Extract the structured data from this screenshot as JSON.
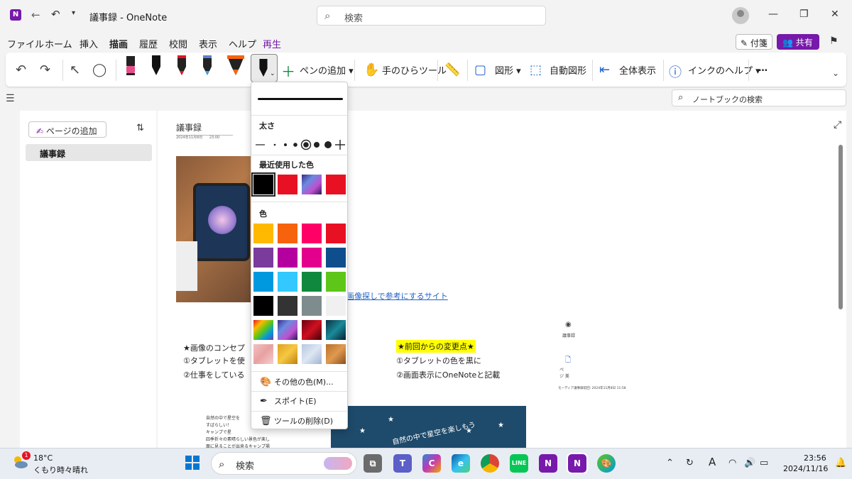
{
  "window": {
    "title": "議事録 - OneNote",
    "app_icon": "N"
  },
  "search": {
    "placeholder": "検索"
  },
  "menubar": {
    "items": [
      "ファイル",
      "ホーム",
      "挿入",
      "描画",
      "履歴",
      "校閲",
      "表示",
      "ヘルプ",
      "再生"
    ],
    "active": "描画",
    "memo_label": "付箋",
    "share_label": "共有"
  },
  "ribbon": {
    "add_pen_label": "ペンの追加",
    "hand_tool_label": "手のひらツール",
    "shapes_label": "図形",
    "auto_shapes_label": "自動図形",
    "fit_label": "全体表示",
    "ink_help_label": "インクのヘルプ",
    "more_label": "…"
  },
  "notebook_search": {
    "placeholder": "ノートブックの検索"
  },
  "pages": {
    "add_label": "ページの追加",
    "items": [
      "議事録"
    ]
  },
  "page": {
    "title": "議事録",
    "date": "2024年11月8日",
    "time": "23:00",
    "link_text": "画像探しで参考にするサイト",
    "left_notes": [
      "★画像のコンセプ",
      "①タブレットを使",
      "②仕事をしている"
    ],
    "changes_title": "★前回からの変更点★",
    "changes": [
      "①タブレットの色を黒に",
      "②画面表示にOneNoteと記載"
    ],
    "icon_label_1": "議事録",
    "icon_label_2": "ペ\nジ 美",
    "footer_small": "モーディア議事録前回: 2024年11月8日 11:58",
    "small_notes": [
      "自然の中で星空を",
      "すばらしい！",
      "キャンプで星",
      "四季折々の素晴らしい景色が楽し",
      "面に見ることが出来るキャンプ場"
    ],
    "poster_text": "自然の中で星空を楽しもう"
  },
  "dropdown": {
    "thickness_label": "太さ",
    "recent_label": "最近使用した色",
    "colors_label": "色",
    "recent_colors": [
      "#000000",
      "#e81123",
      "galaxy",
      "#e81123"
    ],
    "colors": [
      [
        "#ffb900",
        "#f7630c",
        "#ff0066",
        "#e81123"
      ],
      [
        "#7a3b9c",
        "#b4009e",
        "#e3008c",
        "#0f4e8c"
      ],
      [
        "#0099e0",
        "#33c8ff",
        "#10893e",
        "#5ec619"
      ],
      [
        "#000000",
        "#333333",
        "#7f8c8d",
        "#f0f0f0"
      ],
      [
        "rainbow",
        "galaxy",
        "lava",
        "ocean"
      ],
      [
        "rosegold",
        "gold",
        "silver",
        "bronze"
      ]
    ],
    "more_colors_label": "その他の色(M)...",
    "eyedropper_label": "スポイト(E)",
    "delete_tool_label": "ツールの削除(D)"
  },
  "taskbar": {
    "weather_temp": "18°C",
    "weather_desc": "くもり時々晴れ",
    "weather_badge": "1",
    "search_placeholder": "検索",
    "time": "23:56",
    "date": "2024/11/16",
    "tray_ime": "A"
  }
}
